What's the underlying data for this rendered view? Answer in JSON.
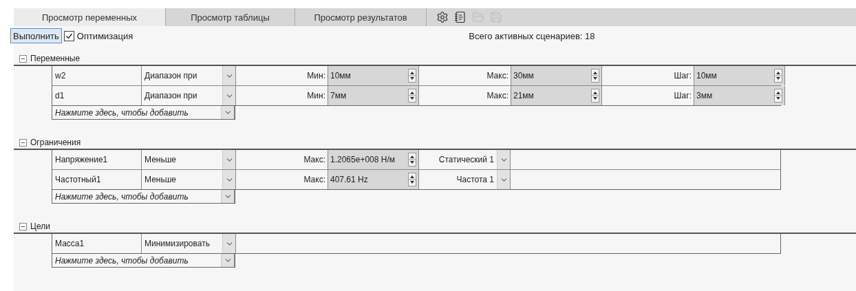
{
  "tabs": [
    {
      "label": "Просмотр переменных",
      "selected": true
    },
    {
      "label": "Просмотр таблицы",
      "selected": false
    },
    {
      "label": "Просмотр результатов",
      "selected": false
    }
  ],
  "toolbar_icons": [
    {
      "kind": "settings",
      "disabled": false
    },
    {
      "kind": "notebook",
      "disabled": false
    },
    {
      "kind": "folder",
      "disabled": true
    },
    {
      "kind": "save",
      "disabled": true
    }
  ],
  "run_button": "Выполнить",
  "optimization": {
    "label": "Оптимизация",
    "checked": true
  },
  "active_scenarios": {
    "label": "Всего активных сценариев:",
    "value": "18"
  },
  "sections": [
    {
      "title": "Переменные",
      "expanded": true,
      "rows": [
        {
          "name": "w2",
          "type": "Диапазон при",
          "params": [
            {
              "label": "Мин:",
              "value": "10мм"
            },
            {
              "label": "Макс:",
              "value": "30мм"
            },
            {
              "label": "Шаг:",
              "value": "10мм"
            }
          ]
        },
        {
          "name": "d1",
          "type": "Диапазон при",
          "params": [
            {
              "label": "Мин:",
              "value": "7мм"
            },
            {
              "label": "Макс:",
              "value": "21мм"
            },
            {
              "label": "Шаг:",
              "value": "3мм"
            }
          ]
        }
      ],
      "add_row": "Нажмите здесь, чтобы добавить"
    },
    {
      "title": "Ограничения",
      "expanded": true,
      "rows": [
        {
          "name": "Напряжение1",
          "type": "Меньше",
          "params": [
            {
              "label": "Макс:",
              "value": "1.2065e+008 Н/м"
            }
          ],
          "study": "Статический 1"
        },
        {
          "name": "Частотный1",
          "type": "Меньше",
          "params": [
            {
              "label": "Макс:",
              "value": "407.61 Hz"
            }
          ],
          "study": "Частота 1"
        }
      ],
      "add_row": "Нажмите здесь, чтобы добавить"
    },
    {
      "title": "Цели",
      "expanded": true,
      "rows": [
        {
          "name": "Масса1",
          "type": "Минимизировать"
        }
      ],
      "add_row": "Нажмите здесь, чтобы добавить"
    }
  ]
}
